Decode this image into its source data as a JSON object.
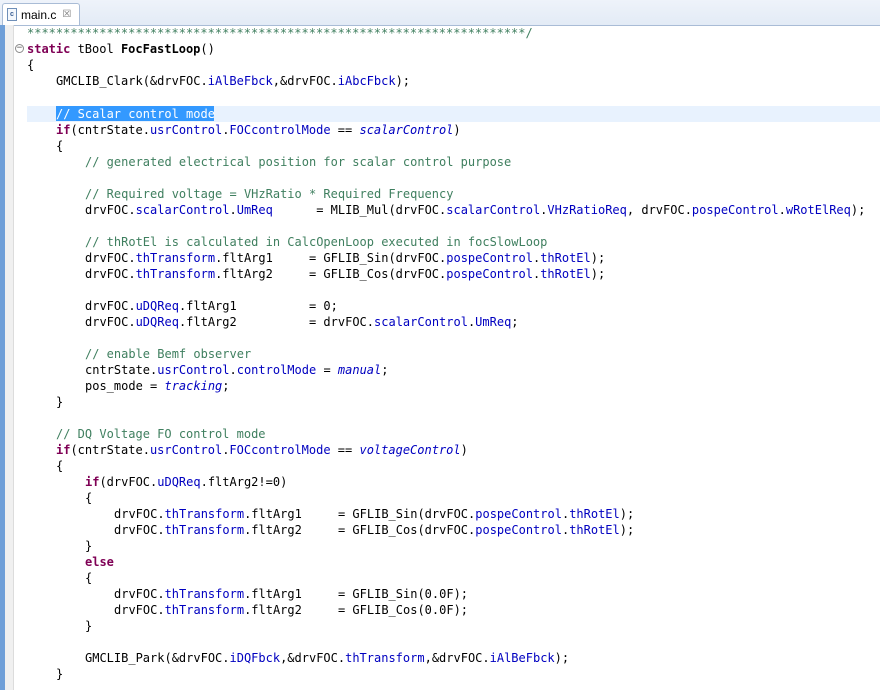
{
  "tab": {
    "title": "main.c",
    "icon": "c-source-file-icon",
    "close": "☒"
  },
  "code": {
    "l0": "*********************************************************************/",
    "l1": {
      "kw": "static",
      "t1": " tBool ",
      "name": "FocFastLoop",
      "t2": "()"
    },
    "l2": "{",
    "l3": {
      "t1": "GMCLIB_Clark(&drvFOC.",
      "f1": "iAlBeFbck",
      "t2": ",&drvFOC.",
      "f2": "iAbcFbck",
      "t3": ");"
    },
    "l5": "// Scalar control mode",
    "l6": {
      "kw": "if",
      "t1": "(cntrState.",
      "f1": "usrControl",
      "t2": ".",
      "f2": "FOCcontrolMode",
      "t3": " == ",
      "v": "scalarControl",
      "t4": ")"
    },
    "l7": "{",
    "l8": "// generated electrical position for scalar control purpose",
    "l10": "// Required voltage = VHzRatio * Required Frequency",
    "l11": {
      "t1": "drvFOC.",
      "f1": "scalarControl",
      "t2": ".",
      "f2": "UmReq",
      "t3": "      = MLIB_Mul(drvFOC.",
      "f3": "scalarControl",
      "t4": ".",
      "f4": "VHzRatioReq",
      "t5": ", drvFOC.",
      "f5": "pospeControl",
      "t6": ".",
      "f6": "wRotElReq",
      "t7": ");"
    },
    "l13": "// thRotEl is calculated in CalcOpenLoop executed in focSlowLoop",
    "l14": {
      "t1": "drvFOC.",
      "f1": "thTransform",
      "t2": ".fltArg1     = GFLIB_Sin(drvFOC.",
      "f2": "pospeControl",
      "t3": ".",
      "f3": "thRotEl",
      "t4": ");"
    },
    "l15": {
      "t1": "drvFOC.",
      "f1": "thTransform",
      "t2": ".fltArg2     = GFLIB_Cos(drvFOC.",
      "f2": "pospeControl",
      "t3": ".",
      "f3": "thRotEl",
      "t4": ");"
    },
    "l17": {
      "t1": "drvFOC.",
      "f1": "uDQReq",
      "t2": ".fltArg1          = 0;"
    },
    "l18": {
      "t1": "drvFOC.",
      "f1": "uDQReq",
      "t2": ".fltArg2          = drvFOC.",
      "f2": "scalarControl",
      "t3": ".",
      "f3": "UmReq",
      "t4": ";"
    },
    "l20": "// enable Bemf observer",
    "l21": {
      "t1": "cntrState.",
      "f1": "usrControl",
      "t2": ".",
      "f2": "controlMode",
      "t3": " = ",
      "v": "manual",
      "t4": ";"
    },
    "l22": {
      "t1": "pos_mode = ",
      "v": "tracking",
      "t2": ";"
    },
    "l23": "}",
    "l25": "// DQ Voltage FO control mode",
    "l26": {
      "kw": "if",
      "t1": "(cntrState.",
      "f1": "usrControl",
      "t2": ".",
      "f2": "FOCcontrolMode",
      "t3": " == ",
      "v": "voltageControl",
      "t4": ")"
    },
    "l27": "{",
    "l28": {
      "kw": "if",
      "t1": "(drvFOC.",
      "f1": "uDQReq",
      "t2": ".fltArg2!=0)"
    },
    "l29": "{",
    "l30": {
      "t1": "drvFOC.",
      "f1": "thTransform",
      "t2": ".fltArg1     = GFLIB_Sin(drvFOC.",
      "f2": "pospeControl",
      "t3": ".",
      "f3": "thRotEl",
      "t4": ");"
    },
    "l31": {
      "t1": "drvFOC.",
      "f1": "thTransform",
      "t2": ".fltArg2     = GFLIB_Cos(drvFOC.",
      "f2": "pospeControl",
      "t3": ".",
      "f3": "thRotEl",
      "t4": ");"
    },
    "l32": "}",
    "l33": "else",
    "l34": "{",
    "l35": {
      "t1": "drvFOC.",
      "f1": "thTransform",
      "t2": ".fltArg1     = GFLIB_Sin(0.0F);"
    },
    "l36": {
      "t1": "drvFOC.",
      "f1": "thTransform",
      "t2": ".fltArg2     = GFLIB_Cos(0.0F);"
    },
    "l37": "}",
    "l39": {
      "t1": "GMCLIB_Park(&drvFOC.",
      "f1": "iDQFbck",
      "t2": ",&drvFOC.",
      "f2": "thTransform",
      "t3": ",&drvFOC.",
      "f3": "iAlBeFbck",
      "t4": ");"
    },
    "l40": "}"
  },
  "colors": {
    "keyword": "#7f0055",
    "comment": "#3f7f5f",
    "field": "#0000c0",
    "selection": "#3399ff",
    "ruler": "#6f9fd8"
  }
}
